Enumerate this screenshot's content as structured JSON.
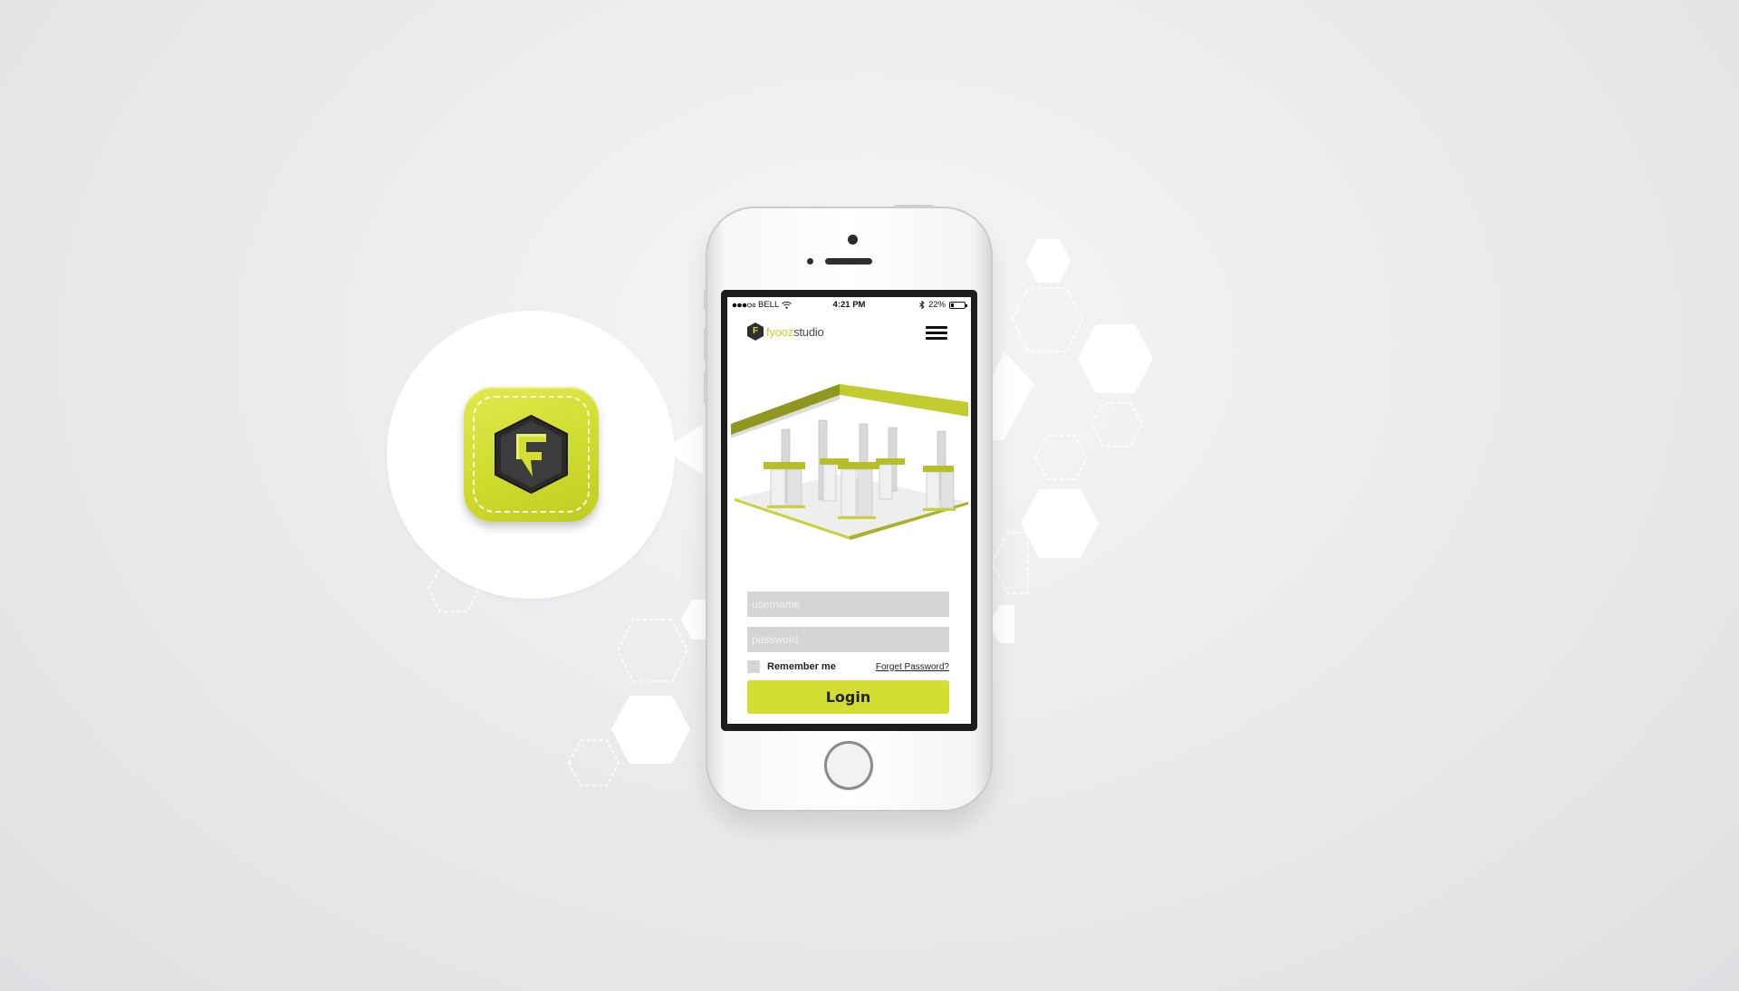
{
  "app_icon": {
    "icon": "fyooz-f-hexagon-icon",
    "letter": "F",
    "accent": "#d3dd32"
  },
  "status_bar": {
    "carrier": "BELL",
    "time": "4:21 PM",
    "battery": "22%",
    "battery_level": 0.22,
    "icons": [
      "signal-dots-icon",
      "wifi-icon",
      "bluetooth-icon",
      "battery-icon"
    ]
  },
  "header": {
    "logo_mark": "F",
    "logo_text_part1": "fyooz",
    "logo_text_part2": "studio",
    "menu_icon": "hamburger-menu-icon"
  },
  "hero": {
    "image": "gas-station-illustration"
  },
  "login": {
    "username_placeholder": "username",
    "password_placeholder": "password",
    "remember_label": "Remember me",
    "forgot_label": "Forget Password?",
    "login_label": "Login"
  },
  "colors": {
    "accent": "#d3dd32",
    "field": "#d5d5d5",
    "screen_bezel": "#1d1d1d"
  }
}
